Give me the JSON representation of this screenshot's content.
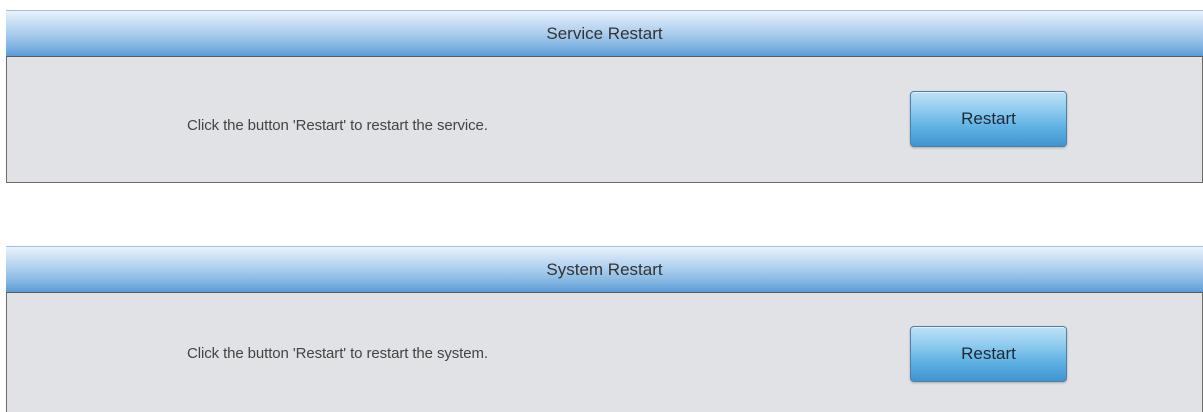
{
  "service_restart": {
    "title": "Service Restart",
    "description": "Click the button 'Restart' to restart the service.",
    "button_label": "Restart"
  },
  "system_restart": {
    "title": "System Restart",
    "description": "Click the button 'Restart' to restart the system.",
    "button_label": "Restart"
  },
  "colors": {
    "header_gradient_top": "#e9f3fc",
    "header_gradient_bottom": "#5b9bd6",
    "panel_body": "#e1e2e5",
    "button_top": "#bfe1f6",
    "button_bottom": "#3f95cf"
  }
}
